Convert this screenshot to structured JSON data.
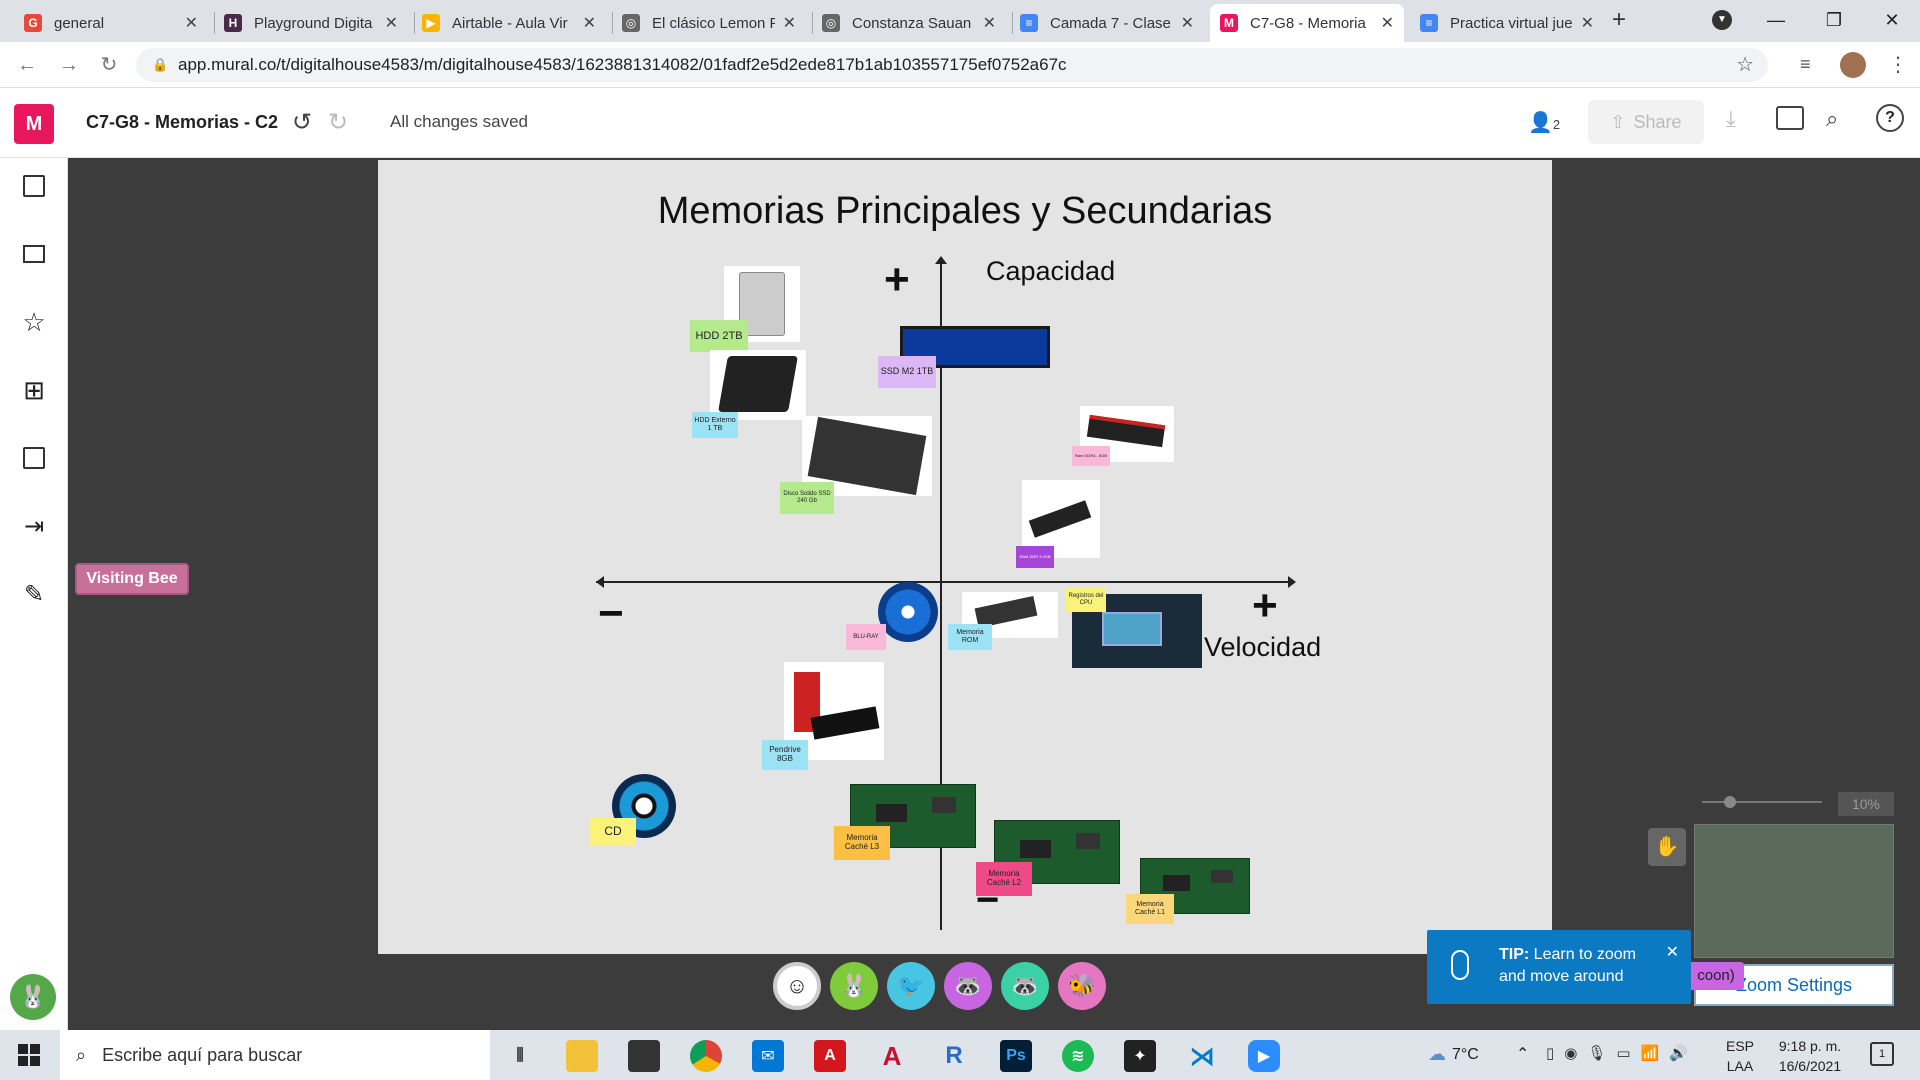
{
  "tabs": [
    {
      "title": "general",
      "icon": "G",
      "color": "#e64a3b"
    },
    {
      "title": "Playground Digita",
      "icon": "H",
      "color": "#4a2a4a"
    },
    {
      "title": "Airtable - Aula Vir",
      "icon": "▶",
      "color": "#fcb400"
    },
    {
      "title": "El clásico Lemon P",
      "icon": "◎",
      "color": "#666"
    },
    {
      "title": "Constanza Sauan",
      "icon": "◎",
      "color": "#666"
    },
    {
      "title": "Camada 7 - Clase",
      "icon": "≡",
      "color": "#4285f4"
    },
    {
      "title": "C7-G8 - Memoria",
      "icon": "M",
      "color": "#e8175d"
    },
    {
      "title": "Practica virtual jue",
      "icon": "≡",
      "color": "#4285f4"
    }
  ],
  "url": "app.mural.co/t/digitalhouse4583/m/digitalhouse4583/1623881314082/01fadf2e5d2ede817b1ab103557175ef0752a67c",
  "header": {
    "logo": "M",
    "title": "C7-G8 - Memorias - C2",
    "saved": "All changes saved",
    "users": "2",
    "share": "Share"
  },
  "visitor": "Visiting Bee",
  "board": {
    "title": "Memorias Principales y Secundarias",
    "capacidad": "Capacidad",
    "velocidad": "Velocidad",
    "plus": "+",
    "minus": "−"
  },
  "notes": {
    "hdd2tb": "HDD 2TB",
    "ssdm2": "SSD M2 1TB",
    "hddext": "HDD Externo 1 TB",
    "ssd240": "Disco Solido SSD 240 Gb",
    "ramddr4": "Ram DDR4 - 8GB",
    "ram3": "RAM DDR 3 4GB",
    "bluray": "BLU-RAY",
    "rom": "Memoria ROM",
    "reg": "Registros del CPU",
    "pendrive": "Pendrive 8GB",
    "cd": "CD",
    "l3": "Memoria Caché L3",
    "l2": "Memoria Caché L2",
    "l1": "Memoria Caché L1"
  },
  "zoom": {
    "pct": "10%",
    "settings": "Zoom Settings",
    "tag": "coon)"
  },
  "tip": {
    "bold": "TIP:",
    "text": "Learn to zoom and move around"
  },
  "taskbar": {
    "search": "Escribe aquí para buscar",
    "temp": "7°C",
    "lang1": "ESP",
    "lang2": "LAA",
    "time": "9:18 p. m.",
    "date": "16/6/2021",
    "notif": "1"
  }
}
